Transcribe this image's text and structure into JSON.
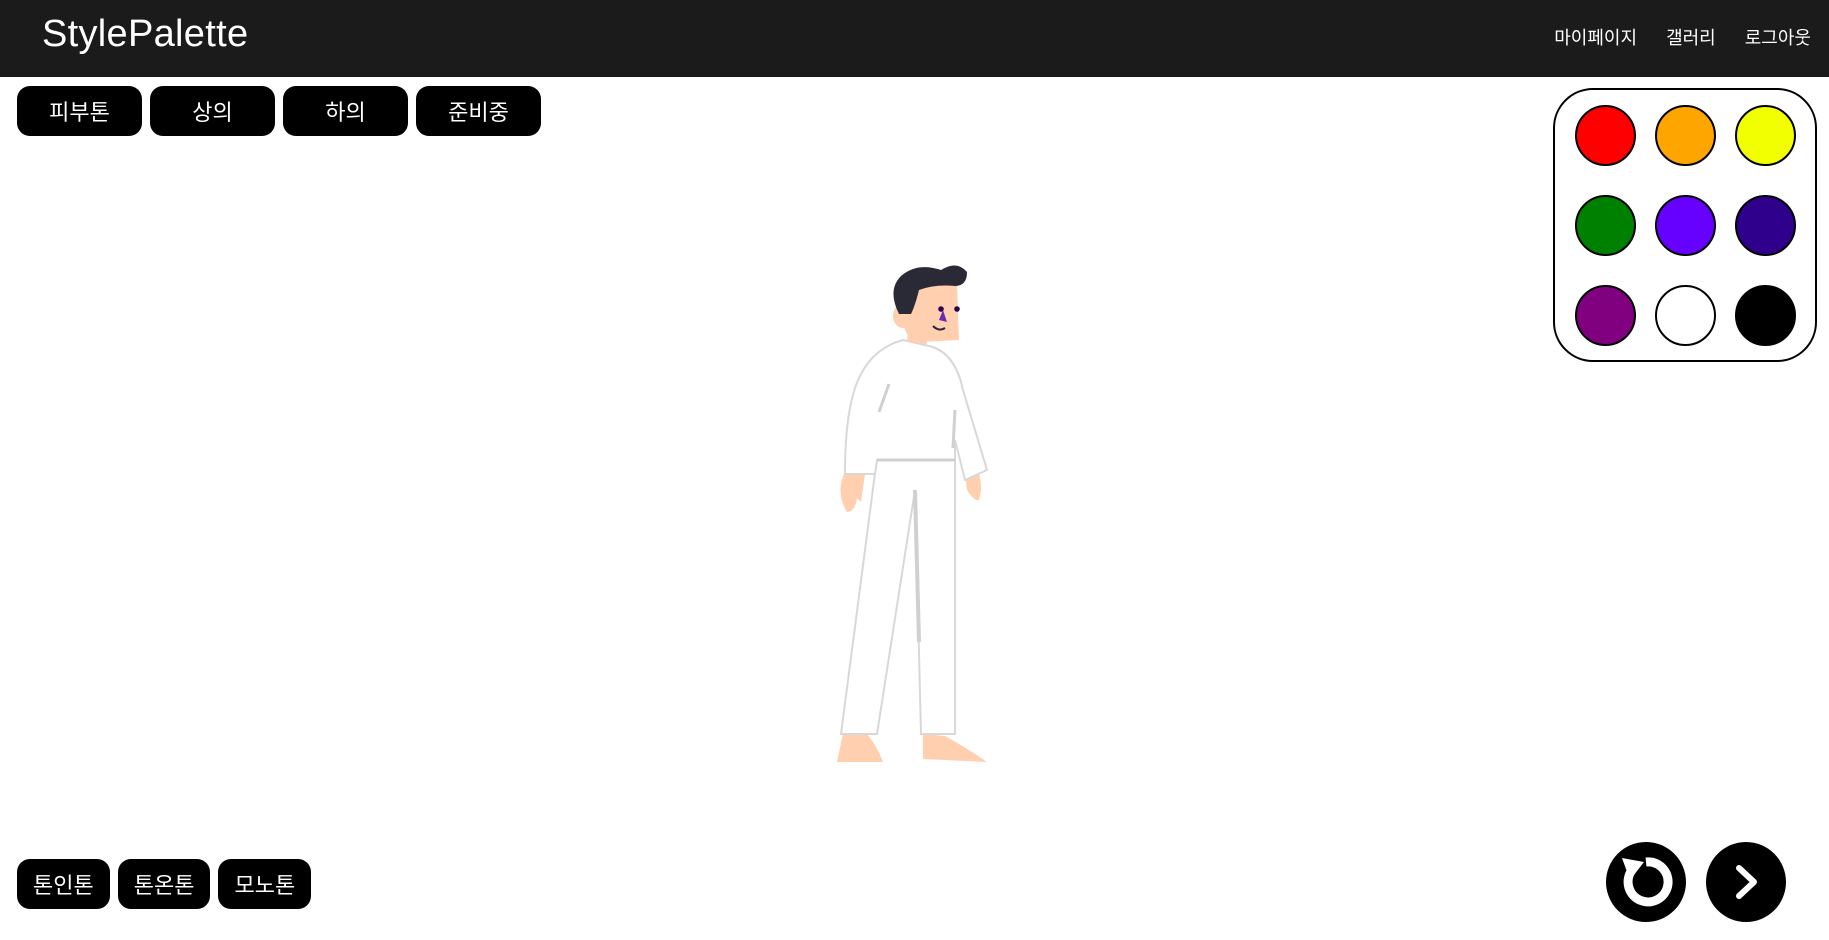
{
  "navbar": {
    "brand": "StylePalette",
    "links": [
      {
        "label": "마이페이지"
      },
      {
        "label": "갤러리"
      },
      {
        "label": "로그아웃"
      }
    ]
  },
  "category_tabs": [
    {
      "label": "피부톤"
    },
    {
      "label": "상의"
    },
    {
      "label": "하의"
    },
    {
      "label": "준비중"
    }
  ],
  "palette": {
    "colors": [
      {
        "name": "red",
        "hex": "#ff0000"
      },
      {
        "name": "orange",
        "hex": "#ffa500"
      },
      {
        "name": "yellow",
        "hex": "#f2ff00"
      },
      {
        "name": "green",
        "hex": "#008000"
      },
      {
        "name": "violet",
        "hex": "#6600ff"
      },
      {
        "name": "indigo",
        "hex": "#2e008b"
      },
      {
        "name": "purple",
        "hex": "#800080"
      },
      {
        "name": "white",
        "hex": "#ffffff"
      },
      {
        "name": "black",
        "hex": "#000000"
      }
    ]
  },
  "harmony_buttons": [
    {
      "label": "톤인톤"
    },
    {
      "label": "톤온톤"
    },
    {
      "label": "모노톤"
    }
  ],
  "controls": {
    "reset_icon": "refresh-icon",
    "next_icon": "chevron-right-icon"
  },
  "figure": {
    "skin_color": "#ffcfb0",
    "hair_color": "#2a2936",
    "top_color": "#ffffff",
    "bottom_color": "#ffffff"
  }
}
